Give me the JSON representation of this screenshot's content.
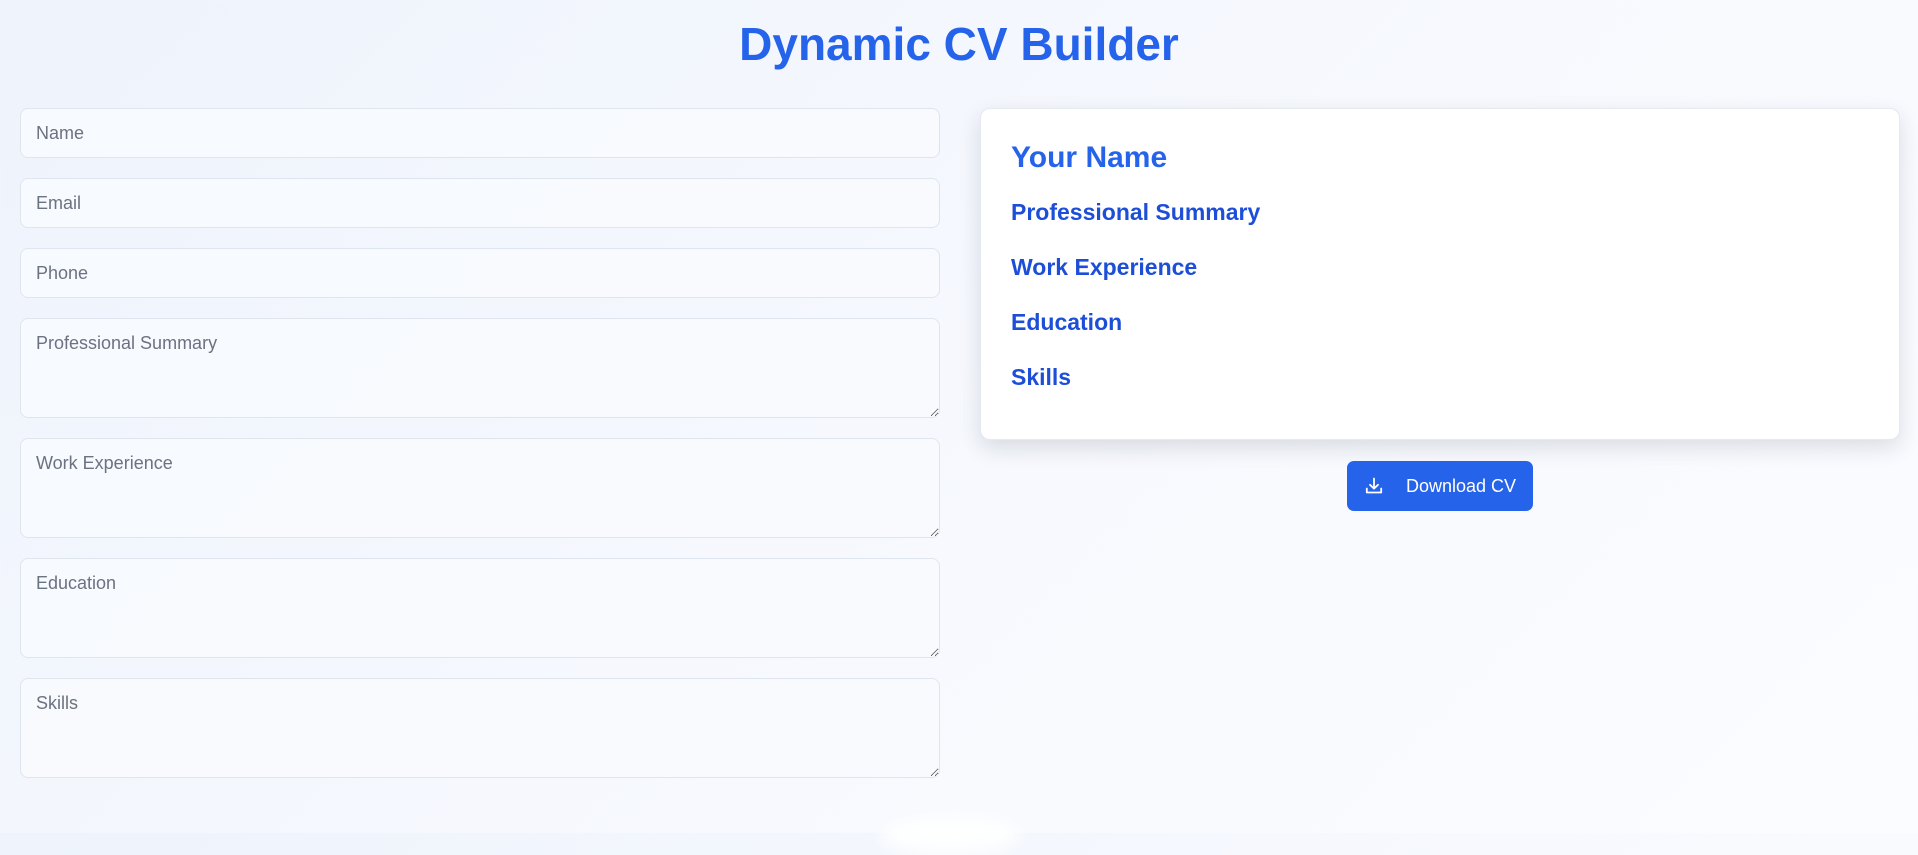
{
  "page": {
    "title": "Dynamic CV Builder",
    "accent_color": "#2563eb"
  },
  "form": {
    "name": {
      "placeholder": "Name",
      "value": ""
    },
    "email": {
      "placeholder": "Email",
      "value": ""
    },
    "phone": {
      "placeholder": "Phone",
      "value": ""
    },
    "summary": {
      "placeholder": "Professional Summary",
      "value": ""
    },
    "experience": {
      "placeholder": "Work Experience",
      "value": ""
    },
    "education": {
      "placeholder": "Education",
      "value": ""
    },
    "skills": {
      "placeholder": "Skills",
      "value": ""
    }
  },
  "preview": {
    "name": "Your Name",
    "sections": {
      "summary": "Professional Summary",
      "experience": "Work Experience",
      "education": "Education",
      "skills": "Skills"
    }
  },
  "download": {
    "label": "Download CV",
    "icon": "download-icon"
  }
}
